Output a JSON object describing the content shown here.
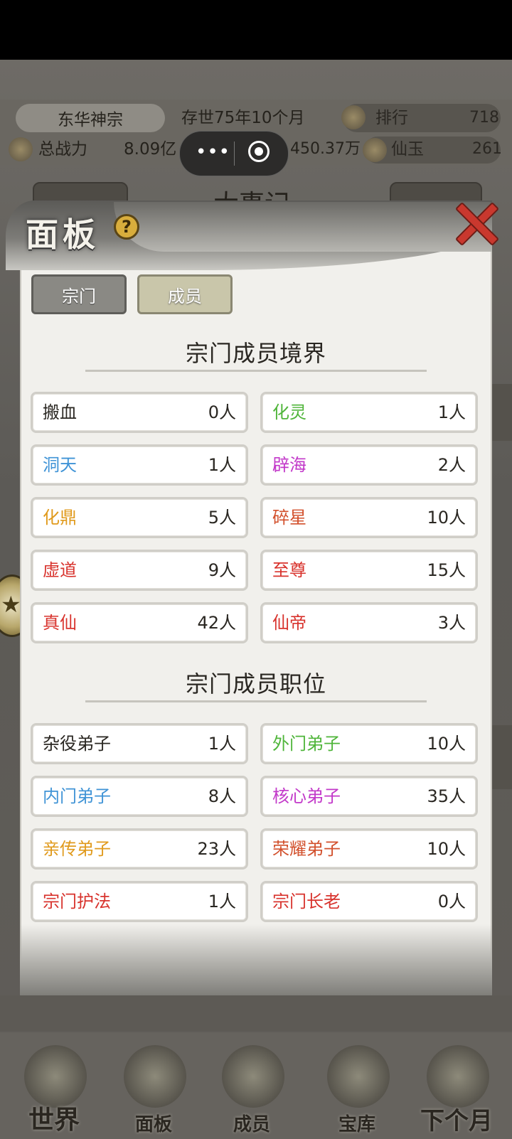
{
  "header": {
    "sect_name": "东华神宗",
    "age": "存世75年10个月",
    "rank_label": "排行",
    "rank_value": "718",
    "power_label": "总战力",
    "power_value": "8.09亿",
    "lingshi_value": "450.37万",
    "xianyu_label": "仙玉",
    "xianyu_value": "261"
  },
  "capsule": {
    "more": "•••"
  },
  "behind": {
    "title": "大事记"
  },
  "panel": {
    "title": "面板",
    "help": "?",
    "tabs": [
      {
        "label": "宗门",
        "active": false
      },
      {
        "label": "成员",
        "active": true
      }
    ],
    "realm_section": {
      "heading": "宗门成员境界",
      "items": [
        {
          "name": "搬血",
          "count": "0人",
          "color": "#2a2722"
        },
        {
          "name": "化灵",
          "count": "1人",
          "color": "#4fb53a"
        },
        {
          "name": "洞天",
          "count": "1人",
          "color": "#3f93d6"
        },
        {
          "name": "辟海",
          "count": "2人",
          "color": "#c238c9"
        },
        {
          "name": "化鼎",
          "count": "5人",
          "color": "#e09a1c"
        },
        {
          "name": "碎星",
          "count": "10人",
          "color": "#d2502c"
        },
        {
          "name": "虚道",
          "count": "9人",
          "color": "#d8332d"
        },
        {
          "name": "至尊",
          "count": "15人",
          "color": "#d8332d"
        },
        {
          "name": "真仙",
          "count": "42人",
          "color": "#d8332d"
        },
        {
          "name": "仙帝",
          "count": "3人",
          "color": "#d8332d"
        }
      ]
    },
    "position_section": {
      "heading": "宗门成员职位",
      "items": [
        {
          "name": "杂役弟子",
          "count": "1人",
          "color": "#2a2722"
        },
        {
          "name": "外门弟子",
          "count": "10人",
          "color": "#4fb53a"
        },
        {
          "name": "内门弟子",
          "count": "8人",
          "color": "#3f93d6"
        },
        {
          "name": "核心弟子",
          "count": "35人",
          "color": "#c238c9"
        },
        {
          "name": "亲传弟子",
          "count": "23人",
          "color": "#e09a1c"
        },
        {
          "name": "荣耀弟子",
          "count": "10人",
          "color": "#d2502c"
        },
        {
          "name": "宗门护法",
          "count": "1人",
          "color": "#d8332d"
        },
        {
          "name": "宗门长老",
          "count": "0人",
          "color": "#d8332d"
        }
      ]
    }
  },
  "bottom_nav": [
    {
      "label": "世界"
    },
    {
      "label": "面板"
    },
    {
      "label": "成员"
    },
    {
      "label": "宝库"
    },
    {
      "label": "下个月"
    }
  ]
}
